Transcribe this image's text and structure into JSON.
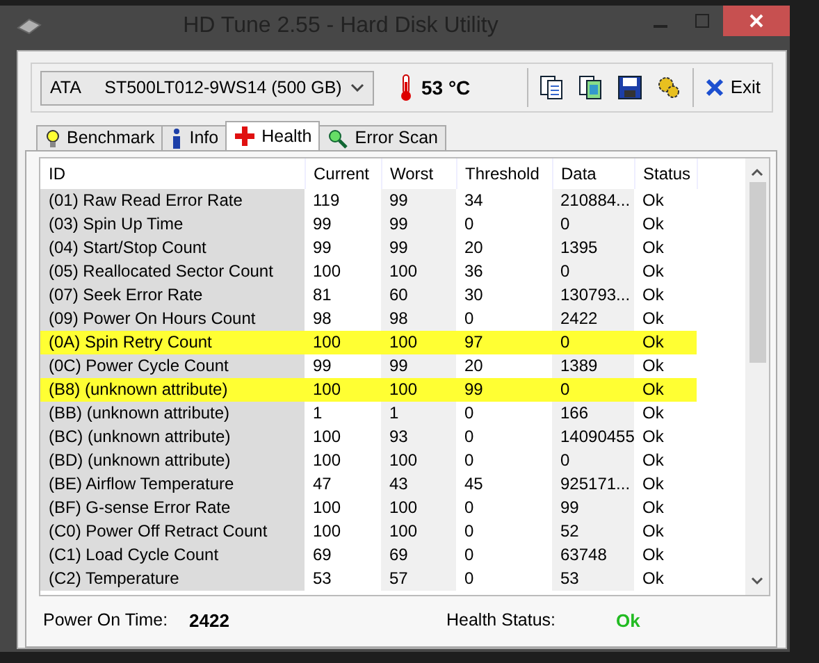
{
  "window": {
    "title": "HD Tune 2.55 - Hard Disk Utility"
  },
  "drive_select": {
    "value": "ATA     ST500LT012-9WS14 (500 GB)"
  },
  "temperature": "53 °C",
  "exit_button": "Exit",
  "tabs": [
    {
      "label": "Benchmark",
      "kind": "bulb",
      "selected": false
    },
    {
      "label": "Info",
      "kind": "info",
      "selected": false
    },
    {
      "label": "Health",
      "kind": "cross",
      "selected": true
    },
    {
      "label": "Error Scan",
      "kind": "magnifier",
      "selected": false
    }
  ],
  "table": {
    "columns": [
      "ID",
      "Current",
      "Worst",
      "Threshold",
      "Data",
      "Status"
    ],
    "rows": [
      {
        "cells": [
          "(01) Raw Read Error Rate",
          "119",
          "99",
          "34",
          "210884...",
          "Ok"
        ],
        "highlighted": false
      },
      {
        "cells": [
          "(03) Spin Up Time",
          "99",
          "99",
          "0",
          "0",
          "Ok"
        ],
        "highlighted": false
      },
      {
        "cells": [
          "(04) Start/Stop Count",
          "99",
          "99",
          "20",
          "1395",
          "Ok"
        ],
        "highlighted": false
      },
      {
        "cells": [
          "(05) Reallocated Sector Count",
          "100",
          "100",
          "36",
          "0",
          "Ok"
        ],
        "highlighted": false
      },
      {
        "cells": [
          "(07) Seek Error Rate",
          "81",
          "60",
          "30",
          "130793...",
          "Ok"
        ],
        "highlighted": false
      },
      {
        "cells": [
          "(09) Power On Hours Count",
          "98",
          "98",
          "0",
          "2422",
          "Ok"
        ],
        "highlighted": false
      },
      {
        "cells": [
          "(0A) Spin Retry Count",
          "100",
          "100",
          "97",
          "0",
          "Ok"
        ],
        "highlighted": true
      },
      {
        "cells": [
          "(0C) Power Cycle Count",
          "99",
          "99",
          "20",
          "1389",
          "Ok"
        ],
        "highlighted": false
      },
      {
        "cells": [
          "(B8) (unknown attribute)",
          "100",
          "100",
          "99",
          "0",
          "Ok"
        ],
        "highlighted": true
      },
      {
        "cells": [
          "(BB) (unknown attribute)",
          "1",
          "1",
          "0",
          "166",
          "Ok"
        ],
        "highlighted": false
      },
      {
        "cells": [
          "(BC) (unknown attribute)",
          "100",
          "93",
          "0",
          "14090455",
          "Ok"
        ],
        "highlighted": false
      },
      {
        "cells": [
          "(BD) (unknown attribute)",
          "100",
          "100",
          "0",
          "0",
          "Ok"
        ],
        "highlighted": false
      },
      {
        "cells": [
          "(BE) Airflow Temperature",
          "47",
          "43",
          "45",
          "925171...",
          "Ok"
        ],
        "highlighted": false
      },
      {
        "cells": [
          "(BF) G-sense Error Rate",
          "100",
          "100",
          "0",
          "99",
          "Ok"
        ],
        "highlighted": false
      },
      {
        "cells": [
          "(C0) Power Off Retract Count",
          "100",
          "100",
          "0",
          "52",
          "Ok"
        ],
        "highlighted": false
      },
      {
        "cells": [
          "(C1) Load Cycle Count",
          "69",
          "69",
          "0",
          "63748",
          "Ok"
        ],
        "highlighted": false
      },
      {
        "cells": [
          "(C2) Temperature",
          "53",
          "57",
          "0",
          "53",
          "Ok"
        ],
        "highlighted": false
      }
    ]
  },
  "footer": {
    "power_on_time_label": "Power On Time:",
    "power_on_time_value": "2422",
    "health_status_label": "Health Status:",
    "health_status_value": "Ok"
  }
}
